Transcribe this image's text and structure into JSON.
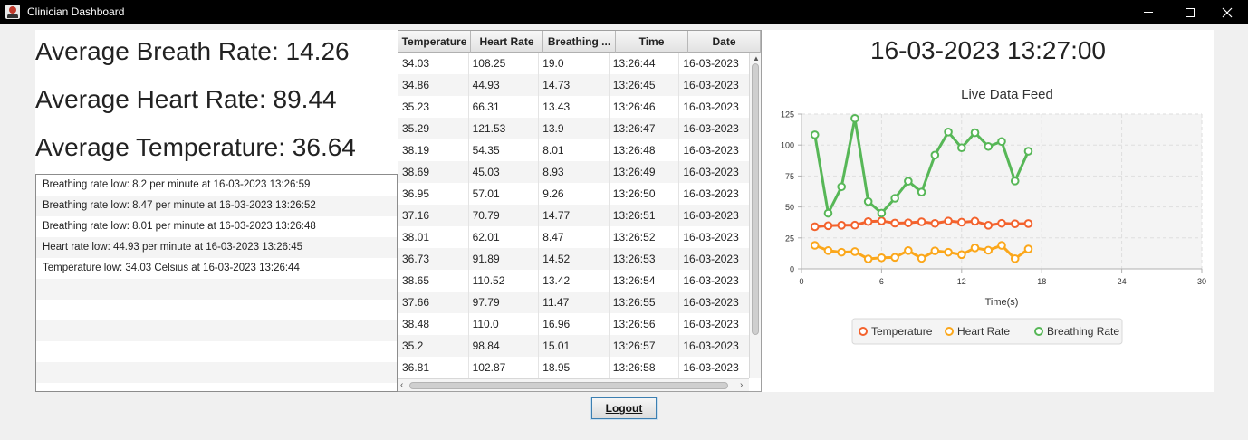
{
  "window": {
    "title": "Clinician Dashboard"
  },
  "averages": {
    "breath": "Average Breath Rate: 14.26",
    "heart": "Average Heart Rate: 89.44",
    "temperature": "Average Temperature: 36.64"
  },
  "alerts": [
    "Breathing rate low: 8.2 per minute at 16-03-2023 13:26:59",
    "Breathing rate low: 8.47 per minute at 16-03-2023 13:26:52",
    "Breathing rate low: 8.01 per minute at 16-03-2023 13:26:48",
    "Heart rate low: 44.93 per minute at 16-03-2023 13:26:45",
    "Temperature low: 34.03 Celsius at 16-03-2023 13:26:44"
  ],
  "table": {
    "headers": [
      "Temperature",
      "Heart Rate",
      "Breathing ...",
      "Time",
      "Date"
    ],
    "rows": [
      [
        "34.03",
        "108.25",
        "19.0",
        "13:26:44",
        "16-03-2023"
      ],
      [
        "34.86",
        "44.93",
        "14.73",
        "13:26:45",
        "16-03-2023"
      ],
      [
        "35.23",
        "66.31",
        "13.43",
        "13:26:46",
        "16-03-2023"
      ],
      [
        "35.29",
        "121.53",
        "13.9",
        "13:26:47",
        "16-03-2023"
      ],
      [
        "38.19",
        "54.35",
        "8.01",
        "13:26:48",
        "16-03-2023"
      ],
      [
        "38.69",
        "45.03",
        "8.93",
        "13:26:49",
        "16-03-2023"
      ],
      [
        "36.95",
        "57.01",
        "9.26",
        "13:26:50",
        "16-03-2023"
      ],
      [
        "37.16",
        "70.79",
        "14.77",
        "13:26:51",
        "16-03-2023"
      ],
      [
        "38.01",
        "62.01",
        "8.47",
        "13:26:52",
        "16-03-2023"
      ],
      [
        "36.73",
        "91.89",
        "14.52",
        "13:26:53",
        "16-03-2023"
      ],
      [
        "38.65",
        "110.52",
        "13.42",
        "13:26:54",
        "16-03-2023"
      ],
      [
        "37.66",
        "97.79",
        "11.47",
        "13:26:55",
        "16-03-2023"
      ],
      [
        "38.48",
        "110.0",
        "16.96",
        "13:26:56",
        "16-03-2023"
      ],
      [
        "35.2",
        "98.84",
        "15.01",
        "13:26:57",
        "16-03-2023"
      ],
      [
        "36.81",
        "102.87",
        "18.95",
        "13:26:58",
        "16-03-2023"
      ]
    ]
  },
  "datetime": "16-03-2023 13:27:00",
  "chart_data": {
    "type": "line",
    "title": "Live Data Feed",
    "xlabel": "Time(s)",
    "ylabel": "",
    "xlim": [
      0,
      30
    ],
    "ylim": [
      0,
      125
    ],
    "xticks": [
      0,
      6,
      12,
      18,
      24,
      30
    ],
    "yticks": [
      0,
      25,
      50,
      75,
      100,
      125
    ],
    "grid": true,
    "legend_position": "bottom",
    "x": [
      1,
      2,
      3,
      4,
      5,
      6,
      7,
      8,
      9,
      10,
      11,
      12,
      13,
      14,
      15,
      16,
      17
    ],
    "series": [
      {
        "name": "Temperature",
        "color": "#f3622d",
        "values": [
          34.03,
          34.86,
          35.23,
          35.29,
          38.19,
          38.69,
          36.95,
          37.16,
          38.01,
          36.73,
          38.65,
          37.66,
          38.48,
          35.2,
          36.81,
          36.4,
          36.6
        ]
      },
      {
        "name": "Heart Rate",
        "color": "#fba71b",
        "values": [
          19.0,
          14.73,
          13.43,
          13.9,
          8.01,
          8.93,
          9.26,
          14.77,
          8.47,
          14.52,
          13.42,
          11.47,
          16.96,
          15.01,
          18.95,
          8.2,
          16.0
        ]
      },
      {
        "name": "Breathing Rate",
        "color": "#57b757",
        "values": [
          108.25,
          44.93,
          66.31,
          121.53,
          54.35,
          45.03,
          57.01,
          70.79,
          62.01,
          91.89,
          110.52,
          97.79,
          110.0,
          98.84,
          102.87,
          71.0,
          95.0
        ]
      }
    ]
  },
  "logout": {
    "label": "Logout"
  }
}
